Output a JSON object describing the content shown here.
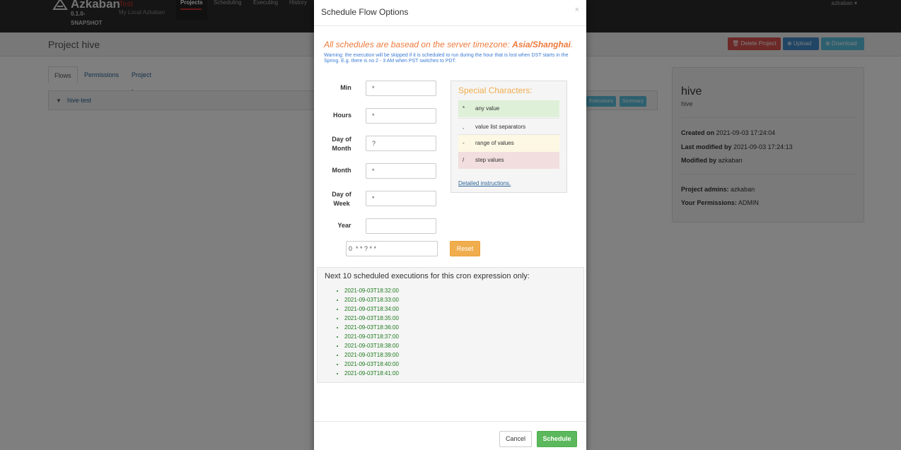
{
  "navbar": {
    "brand": "Azkaban",
    "version": "0.1.0-SNAPSHOT",
    "env_name": "Test",
    "env_desc": "My Local Azkaban",
    "items": [
      {
        "label": "Projects"
      },
      {
        "label": "Scheduling"
      },
      {
        "label": "Executing"
      },
      {
        "label": "History"
      }
    ],
    "user": "azkaban ▾"
  },
  "page": {
    "title": "Project hive",
    "buttons": {
      "delete": "🗑 Delete Project",
      "upload": "⊕ Upload",
      "download": "⊕ Download"
    },
    "tabs": [
      {
        "label": "Flows"
      },
      {
        "label": "Permissions"
      },
      {
        "label": "Project Logs"
      }
    ],
    "flow": {
      "name": "hive-test",
      "executions_label": "Executions",
      "summary_label": "Summary"
    },
    "side": {
      "name": "hive",
      "desc": "hive",
      "created_label": "Created on",
      "created_value": "2021-09-03 17:24:04",
      "modified_label": "Last modified by",
      "modified_value": "2021-09-03 17:24:13",
      "modified_by_label": "Modified by",
      "modified_by_value": "azkaban",
      "admins_label": "Project admins:",
      "admins_value": "azkaban",
      "perms_label": "Your Permissions:",
      "perms_value": "ADMIN"
    }
  },
  "modal": {
    "title": "Schedule Flow Options",
    "close": "×",
    "tz_prefix": "All schedules are basead on the server timezone: ",
    "tz_value": "Asia/Shanghai",
    "tz_suffix": ".",
    "warning": "Warning: the execution will be skipped if it is scheduled to run during the hour that is lost when DST starts in the Spring. E.g. there is no 2 - 3 AM when PST switches to PDT.",
    "fields": {
      "min": {
        "label": "Min",
        "value": "*"
      },
      "hours": {
        "label": "Hours",
        "value": "*"
      },
      "dom": {
        "label": "Day of Month",
        "value": "?"
      },
      "month": {
        "label": "Month",
        "value": "*"
      },
      "dow": {
        "label": "Day of Week",
        "value": "*"
      },
      "year": {
        "label": "Year",
        "value": ""
      }
    },
    "cron_expression": "0  * * ? * *",
    "reset_label": "Reset",
    "special": {
      "title": "Special Characters:",
      "rows": [
        {
          "sym": "*",
          "desc": "any value",
          "color": "#dff0d8"
        },
        {
          "sym": ",",
          "desc": "value list separators",
          "color": "#f5f5f5"
        },
        {
          "sym": "-",
          "desc": "range of values",
          "color": "#fcf8e3"
        },
        {
          "sym": "/",
          "desc": "step values",
          "color": "#f2dede"
        }
      ],
      "link": "Detailed instructions."
    },
    "next": {
      "title": "Next 10 scheduled executions for this cron expression only:",
      "items": [
        "2021-09-03T18:32:00",
        "2021-09-03T18:33:00",
        "2021-09-03T18:34:00",
        "2021-09-03T18:35:00",
        "2021-09-03T18:36:00",
        "2021-09-03T18:37:00",
        "2021-09-03T18:38:00",
        "2021-09-03T18:39:00",
        "2021-09-03T18:40:00",
        "2021-09-03T18:41:00"
      ]
    },
    "footer": {
      "cancel": "Cancel",
      "schedule": "Schedule"
    }
  }
}
